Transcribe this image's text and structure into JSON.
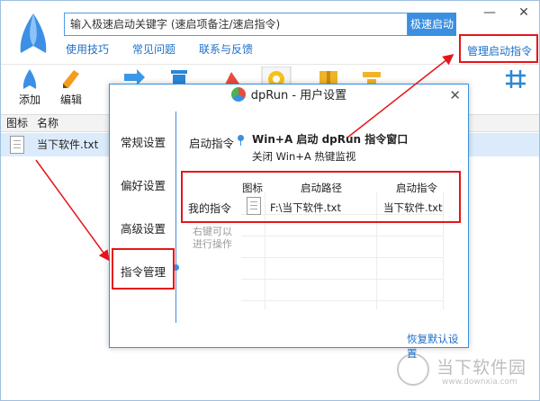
{
  "main": {
    "search_placeholder": "输入极速启动关键字 (速启项备注/速启指令)",
    "search_button": "极速启动",
    "links": [
      "使用技巧",
      "常见问题",
      "联系与反馈"
    ],
    "manage_link": "管理启动指令",
    "window_controls": {
      "minimize": "—",
      "close": "✕"
    },
    "toolbar": [
      {
        "label": "添加",
        "icon": "add-app-icon"
      },
      {
        "label": "编辑",
        "icon": "pencil-icon"
      },
      {
        "label": "",
        "icon": "arrow-icon"
      },
      {
        "label": "",
        "icon": "trash-icon"
      },
      {
        "label": "",
        "icon": "triangle-icon"
      },
      {
        "label": "",
        "icon": "gear-icon"
      },
      {
        "label": "",
        "icon": "box-icon"
      },
      {
        "label": "",
        "icon": "network-icon"
      },
      {
        "label": "",
        "icon": "grid-icon"
      }
    ],
    "list_columns": [
      "图标",
      "名称"
    ],
    "list_rows": [
      {
        "name": "当下软件.txt"
      }
    ]
  },
  "dialog": {
    "title": "dpRun - 用户设置",
    "close": "✕",
    "nav": [
      "常规设置",
      "偏好设置",
      "高级设置",
      "指令管理"
    ],
    "active_nav": "指令管理",
    "launch_label": "启动指令",
    "launch_hotkey": "Win+A 启动 dpRun 指令窗口",
    "launch_disable": "关闭 Win+A 热键监视",
    "table_columns": [
      "图标",
      "启动路径",
      "启动指令"
    ],
    "my_commands_label": "我的指令",
    "rows": [
      {
        "path": "F:\\当下软件.txt",
        "command": "当下软件.txt"
      }
    ],
    "right_click_hint_1": "右键可以",
    "right_click_hint_2": "进行操作",
    "restore_defaults": "恢复默认设置"
  },
  "watermark": {
    "text": "当下软件园",
    "sub": "www.downxia.com"
  },
  "colors": {
    "accent": "#3b8fe0",
    "highlight_red": "#e5151b",
    "link": "#1e6fc7"
  }
}
